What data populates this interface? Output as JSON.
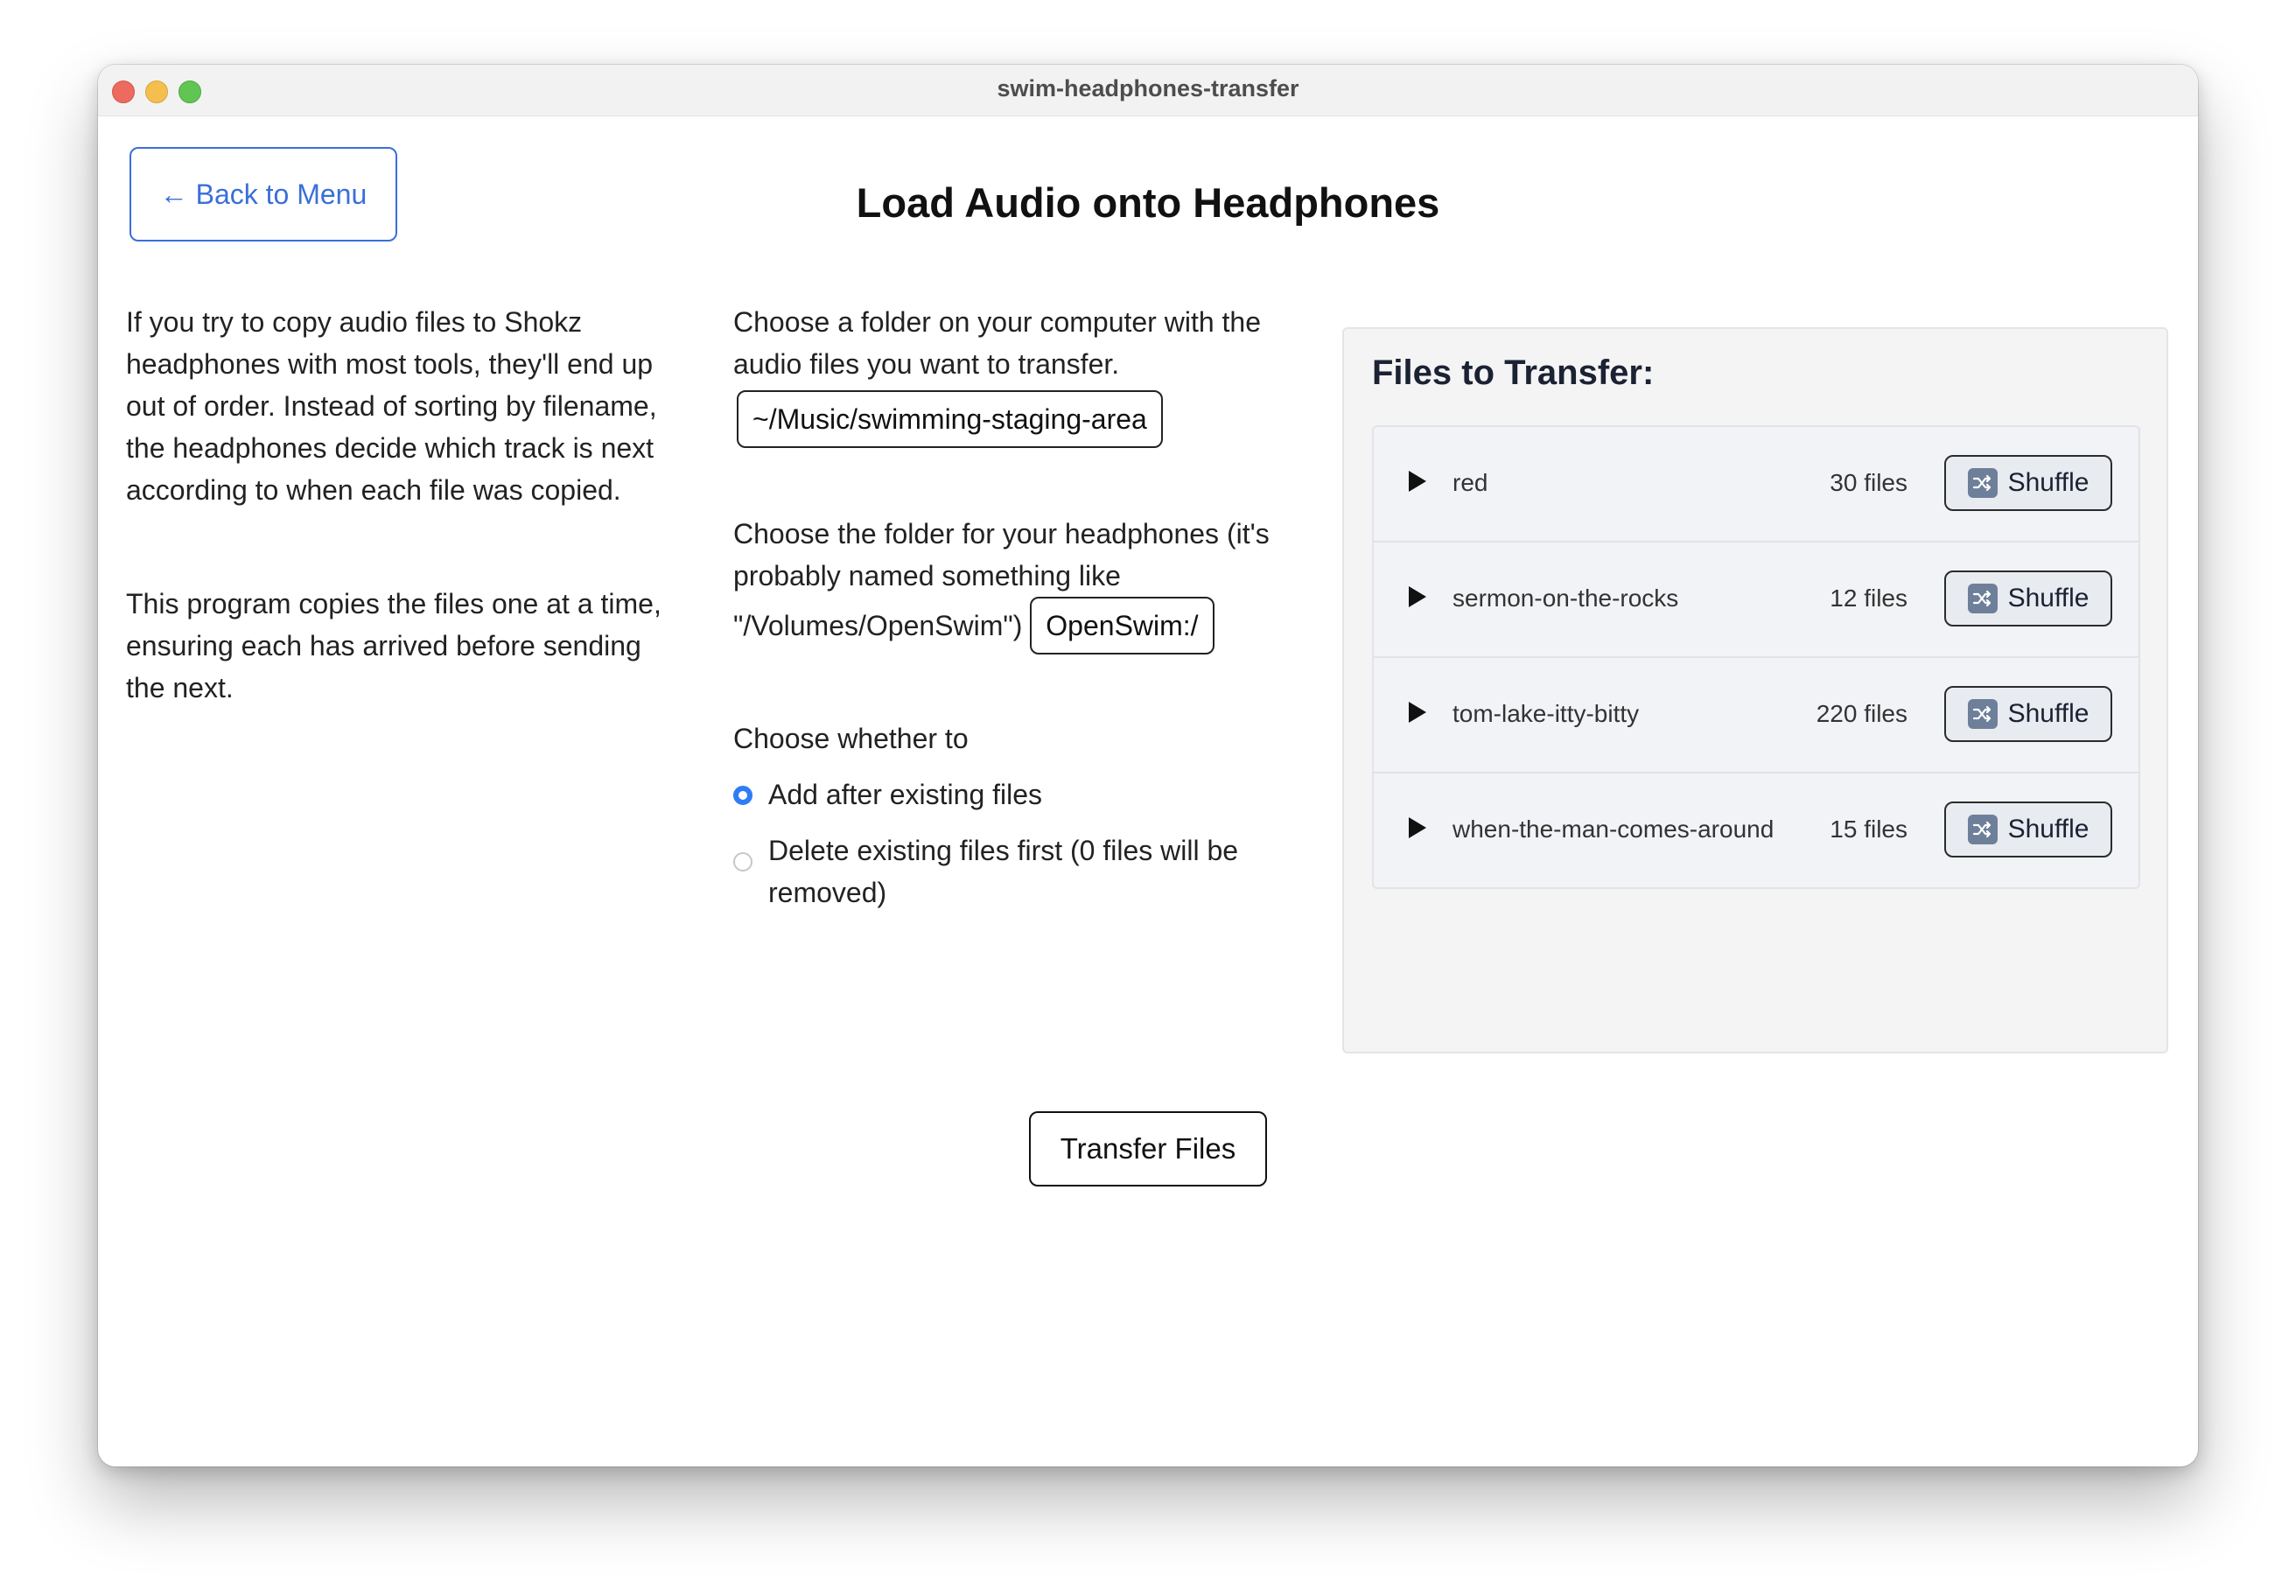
{
  "window": {
    "title": "swim-headphones-transfer"
  },
  "nav": {
    "back_label": "← Back to Menu"
  },
  "page": {
    "title": "Load Audio onto Headphones"
  },
  "intro": {
    "paragraph1": "If you try to copy audio files to Shokz headphones with most tools, they'll end up out of order. Instead of sorting by filename, the headphones decide which track is next according to when each file was copied.",
    "paragraph2": "This program copies the files one at a time, ensuring each has arrived before sending the next."
  },
  "source": {
    "instruction": "Choose a folder on your computer with the audio files you want to transfer.",
    "path": "~/Music/swimming-staging-area"
  },
  "destination": {
    "instruction": "Choose the folder for your headphones (it's probably named something like \"/Volumes/OpenSwim\")",
    "path": "OpenSwim:/"
  },
  "mode": {
    "prompt": "Choose whether to",
    "options": [
      {
        "label": "Add after existing files",
        "selected": true
      },
      {
        "label": "Delete existing files first (0 files will be removed)",
        "selected": false
      }
    ]
  },
  "files_panel": {
    "title": "Files to Transfer:",
    "shuffle_label": "Shuffle",
    "folders": [
      {
        "name": "red",
        "count": "30 files"
      },
      {
        "name": "sermon-on-the-rocks",
        "count": "12 files"
      },
      {
        "name": "tom-lake-itty-bitty",
        "count": "220 files"
      },
      {
        "name": "when-the-man-comes-around",
        "count": "15 files"
      }
    ]
  },
  "actions": {
    "transfer_label": "Transfer Files"
  },
  "colors": {
    "accent": "#3a6fd8",
    "radio_selected": "#2f7cf6",
    "panel_bg": "#f4f4f5"
  },
  "icons": {
    "back": "arrow-left-icon",
    "play": "play-icon",
    "shuffle": "shuffle-icon"
  }
}
